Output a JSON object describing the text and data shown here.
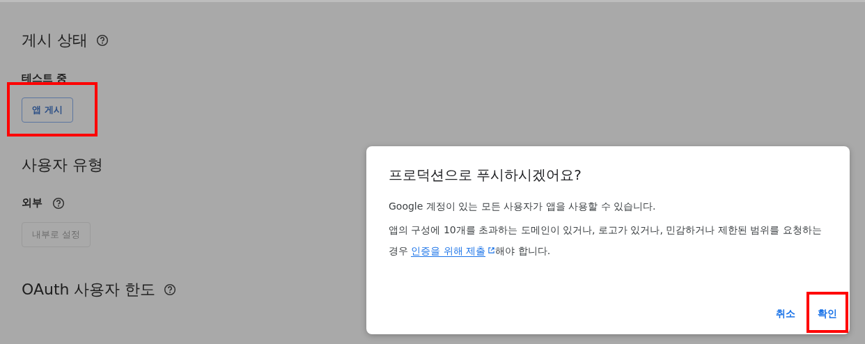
{
  "sections": [
    {
      "title": "게시 상태",
      "help": true,
      "status": "테스트 중",
      "status_help": false,
      "button": {
        "label": "앱 게시",
        "disabled": false,
        "highlighted": true
      }
    },
    {
      "title": "사용자 유형",
      "help": false,
      "status": "외부",
      "status_help": true,
      "button": {
        "label": "내부로 설정",
        "disabled": true,
        "highlighted": false
      }
    },
    {
      "title": "OAuth 사용자 한도",
      "help": true
    }
  ],
  "dialog": {
    "title": "프로덕션으로 푸시하시겠어요?",
    "message": "Google 계정이 있는 모든 사용자가 앱을 사용할 수 있습니다.",
    "note_before": "앱의 구성에 10개를 초과하는 도메인이 있거나, 로고가 있거나, 민감하거나 제한된 범위를 요청하는 경우 ",
    "note_link": "인증을 위해 제출",
    "note_after": "해야 합니다.",
    "buttons": [
      {
        "label": "취소",
        "highlighted": false
      },
      {
        "label": "확인",
        "highlighted": true
      }
    ]
  }
}
